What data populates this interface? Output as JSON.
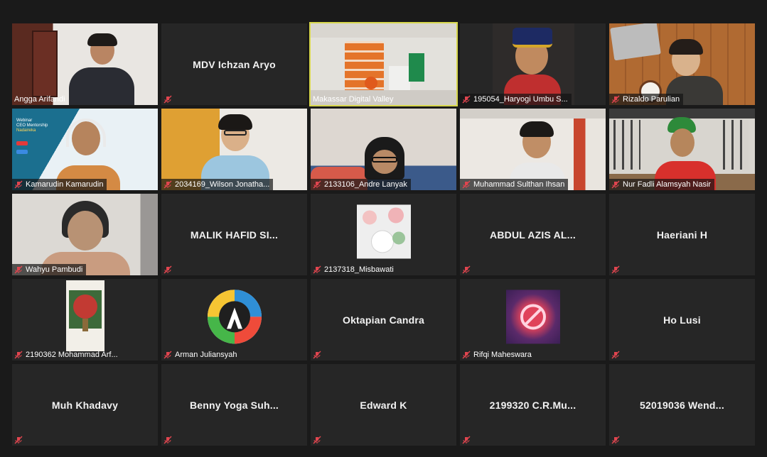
{
  "participants": [
    {
      "name": "Angga Arifandi",
      "type": "video"
    },
    {
      "name": "MDV Ichzan Aryo",
      "type": "name"
    },
    {
      "name": "Makassar Digital Valley",
      "type": "video",
      "active": true
    },
    {
      "name": "195054_Haryogi Umbu S...",
      "type": "video"
    },
    {
      "name": "Rizaldo Parulian",
      "type": "video"
    },
    {
      "name": "Kamarudin Kamarudin",
      "type": "video",
      "slide_text": [
        "Webinar",
        "CEO Mentorship",
        "Nadaireka"
      ]
    },
    {
      "name": "2034169_Wilson Jonatha...",
      "type": "video"
    },
    {
      "name": "2133106_Andre Lanyak",
      "type": "video"
    },
    {
      "name": "Muhammad Sulthan Ihsan",
      "type": "video"
    },
    {
      "name": "Nur Fadli Alamsyah Nasir",
      "type": "video"
    },
    {
      "name": "Wahyu Pambudi",
      "type": "video"
    },
    {
      "name": "MALIK HAFID SI...",
      "type": "name"
    },
    {
      "name": "2137318_Misbawati",
      "type": "avatar"
    },
    {
      "name": "ABDUL AZIS AL...",
      "type": "name"
    },
    {
      "name": "Haeriani H",
      "type": "name"
    },
    {
      "name": "2190362 Mohammad Arf...",
      "type": "avatar"
    },
    {
      "name": "Arman Juliansyah",
      "type": "avatar"
    },
    {
      "name": "Oktapian Candra",
      "type": "name"
    },
    {
      "name": "Rifqi Maheswara",
      "type": "avatar"
    },
    {
      "name": "Ho Lusi",
      "type": "name"
    },
    {
      "name": "Muh Khadavy",
      "type": "name"
    },
    {
      "name": "Benny Yoga Suh...",
      "type": "name"
    },
    {
      "name": "Edward K",
      "type": "name"
    },
    {
      "name": "2199320 C.R.Mu...",
      "type": "name"
    },
    {
      "name": "52019036 Wend...",
      "type": "name"
    }
  ],
  "colors": {
    "background": "#1a1a1a",
    "tile": "#262626",
    "active_speaker_border": "#d8d74d",
    "mute_icon": "#e0454f"
  },
  "icons": {
    "muted": "microphone-muted-icon"
  }
}
